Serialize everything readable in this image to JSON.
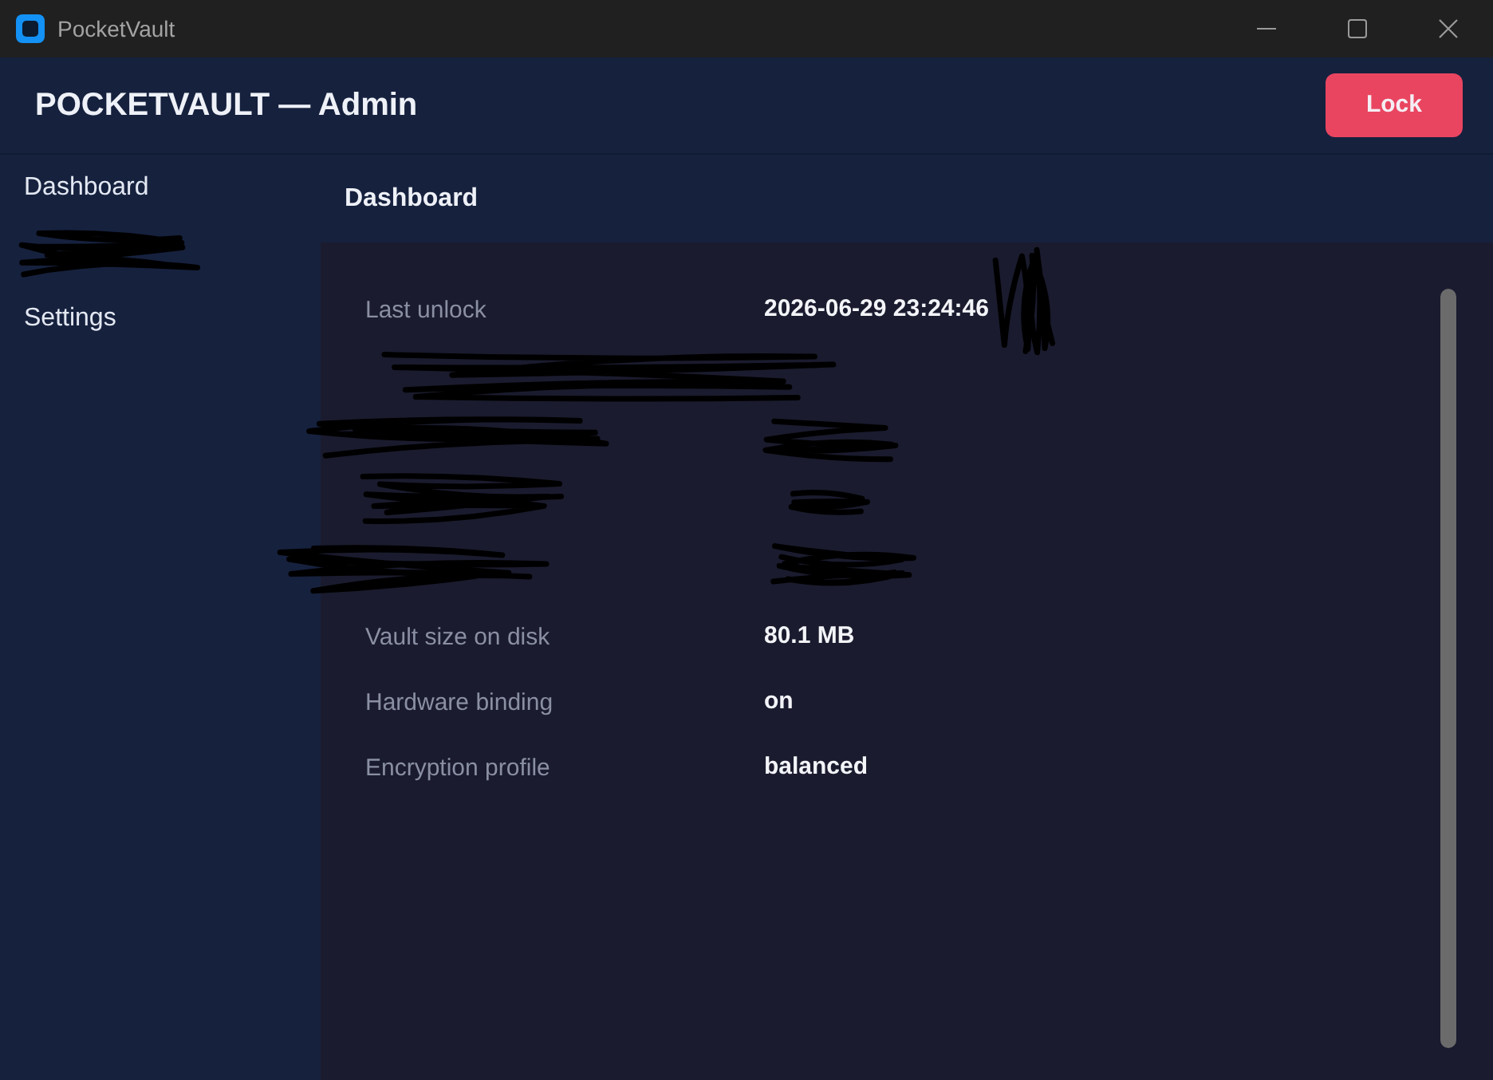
{
  "window": {
    "title": "PocketVault"
  },
  "header": {
    "title": "POCKETVAULT — Admin",
    "lock_button": "Lock"
  },
  "sidebar": {
    "items": [
      {
        "kind": "link",
        "label": "Dashboard"
      },
      {
        "kind": "redacted"
      },
      {
        "kind": "link",
        "label": "Settings"
      }
    ]
  },
  "page": {
    "title": "Dashboard",
    "rows": [
      {
        "kind": "pair",
        "label": "Last unlock",
        "value": "2026-06-29 23:24:46",
        "value_tail_redacted": true
      },
      {
        "kind": "redacted"
      },
      {
        "kind": "redacted"
      },
      {
        "kind": "redacted"
      },
      {
        "kind": "redacted"
      },
      {
        "kind": "pair",
        "label": "Vault size on disk",
        "value": "80.1 MB",
        "value_tail_redacted": false
      },
      {
        "kind": "pair",
        "label": "Hardware binding",
        "value": "on",
        "value_tail_redacted": false
      },
      {
        "kind": "pair",
        "label": "Encryption profile",
        "value": "balanced",
        "value_tail_redacted": false
      }
    ]
  }
}
